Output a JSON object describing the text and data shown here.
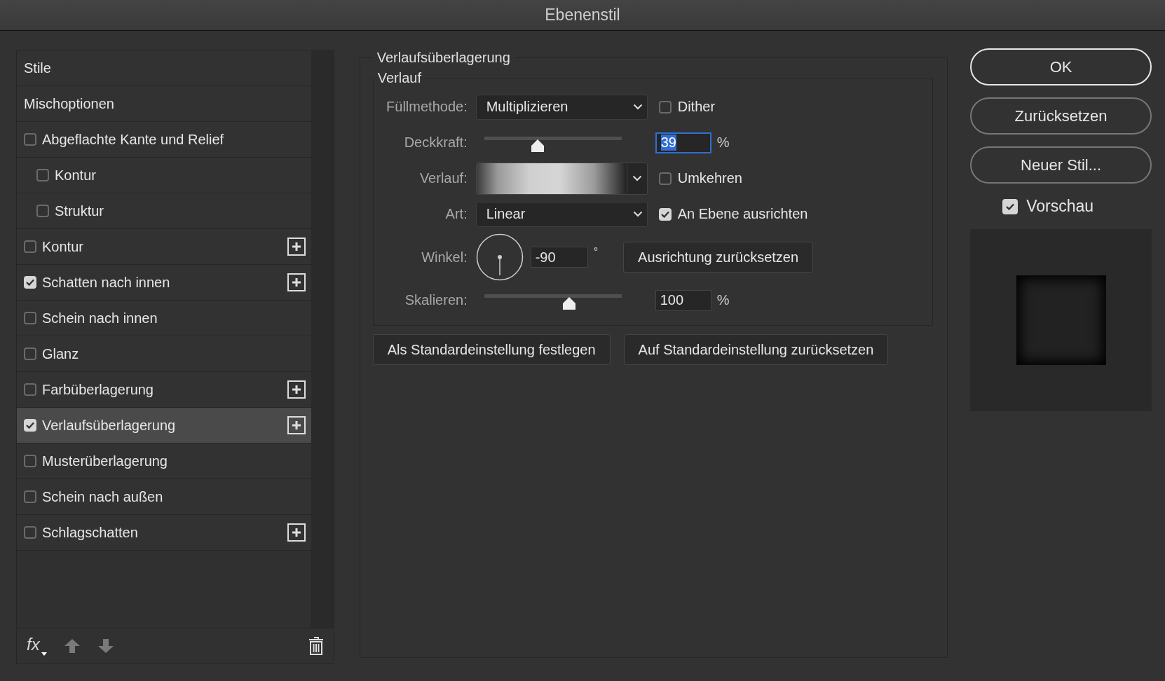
{
  "window": {
    "title": "Ebenenstil"
  },
  "styles_list": {
    "items": [
      {
        "label": "Stile",
        "kind": "header",
        "selected": false
      },
      {
        "label": "Mischoptionen",
        "kind": "header",
        "selected": false
      },
      {
        "label": "Abgeflachte Kante und Relief",
        "kind": "checkbox",
        "checked": false,
        "selected": false,
        "children": [
          {
            "label": "Kontur",
            "kind": "checkbox",
            "checked": false,
            "selected": false
          },
          {
            "label": "Struktur",
            "kind": "checkbox",
            "checked": false,
            "selected": false
          }
        ]
      },
      {
        "label": "Kontur",
        "kind": "checkbox",
        "checked": false,
        "selected": false,
        "addable": true
      },
      {
        "label": "Schatten nach innen",
        "kind": "checkbox",
        "checked": true,
        "selected": false,
        "addable": true
      },
      {
        "label": "Schein nach innen",
        "kind": "checkbox",
        "checked": false,
        "selected": false
      },
      {
        "label": "Glanz",
        "kind": "checkbox",
        "checked": false,
        "selected": false
      },
      {
        "label": "Farbüberlagerung",
        "kind": "checkbox",
        "checked": false,
        "selected": false,
        "addable": true
      },
      {
        "label": "Verlaufsüberlagerung",
        "kind": "checkbox",
        "checked": true,
        "selected": true,
        "addable": true
      },
      {
        "label": "Musterüberlagerung",
        "kind": "checkbox",
        "checked": false,
        "selected": false
      },
      {
        "label": "Schein nach außen",
        "kind": "checkbox",
        "checked": false,
        "selected": false
      },
      {
        "label": "Schlagschatten",
        "kind": "checkbox",
        "checked": false,
        "selected": false,
        "addable": true
      }
    ],
    "footer": {
      "fx_label": "fx"
    }
  },
  "settings": {
    "title": "Verlaufsüberlagerung",
    "group_title": "Verlauf",
    "fill_method": {
      "label": "Füllmethode:",
      "value": "Multiplizieren"
    },
    "dither": {
      "label": "Dither",
      "checked": false
    },
    "opacity": {
      "label": "Deckkraft:",
      "level": 0.39,
      "value": "39",
      "unit": "%",
      "text_selected": true
    },
    "gradient": {
      "label": "Verlauf:"
    },
    "reverse": {
      "label": "Umkehren",
      "checked": false
    },
    "style": {
      "label": "Art:",
      "value": "Linear"
    },
    "align": {
      "label": "An Ebene ausrichten",
      "checked": true
    },
    "angle": {
      "label": "Winkel:",
      "value": "-90",
      "unit": "°"
    },
    "reset_alignment_button": "Ausrichtung zurücksetzen",
    "scale": {
      "label": "Skalieren:",
      "level": 0.62,
      "value": "100",
      "unit": "%"
    },
    "buttons": [
      "Als Standardeinstellung festlegen",
      "Auf Standardeinstellung zurücksetzen"
    ]
  },
  "actions": [
    {
      "label": "OK",
      "default": true
    },
    {
      "label": "Zurücksetzen",
      "default": false
    },
    {
      "label": "Neuer Stil...",
      "default": false
    }
  ],
  "preview": {
    "label": "Vorschau",
    "checked": true
  }
}
